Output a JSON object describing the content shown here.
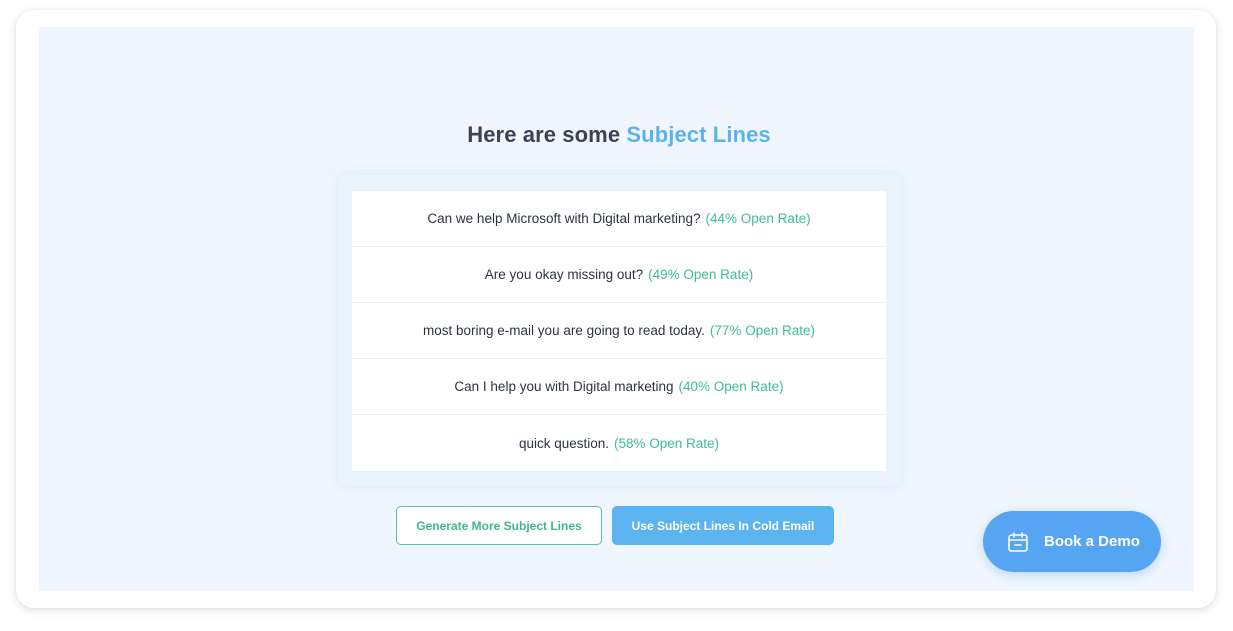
{
  "heading": {
    "prefix": "Here are some",
    "accent": "Subject Lines"
  },
  "subject_lines": [
    {
      "text": "Can we help Microsoft with Digital marketing?",
      "rate": "(44% Open Rate)"
    },
    {
      "text": "Are you okay missing out?",
      "rate": "(49% Open Rate)"
    },
    {
      "text": "most boring e-mail you are going to read today.",
      "rate": "(77% Open Rate)"
    },
    {
      "text": "Can I help you with Digital marketing",
      "rate": "(40% Open Rate)"
    },
    {
      "text": "quick question.",
      "rate": "(58% Open Rate)"
    }
  ],
  "actions": {
    "generate_label": "Generate More Subject Lines",
    "use_label": "Use Subject Lines In Cold Email"
  },
  "demo": {
    "label": "Book a Demo",
    "icon": "calendar-icon"
  },
  "colors": {
    "accent_blue": "#5bb3ea",
    "rate_green": "#3dbd94",
    "panel_bg": "#eff6fe",
    "demo_blue": "#55a5f2"
  }
}
